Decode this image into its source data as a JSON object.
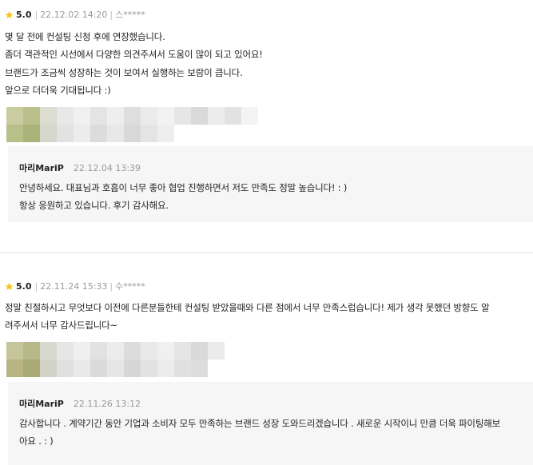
{
  "reviews": [
    {
      "rating": "5.0",
      "date": "22.12.02 14:20",
      "author": "스*****",
      "lines": [
        "몇 달 전에 컨설팅 신청 후에 연장했습니다.",
        "좀더 객관적인 시선에서 다양한 의견주셔서 도움이 많이 되고 있어요!",
        "브랜드가 조금씩 성장하는 것이 보여서 실행하는 보람이 큽니다.",
        "앞으로 더더욱 기대됩니다 :)"
      ],
      "reply": {
        "name": "마리MariP",
        "date": "22.12.04 13:39",
        "lines": [
          "안녕하세요. 대표님과 호흡이 너무 좋아 협업 진행하면서 저도 만족도 정말 높습니다! : )",
          "항상 응원하고 있습니다. 후기 감사해요."
        ]
      }
    },
    {
      "rating": "5.0",
      "date": "22.11.24 15:33",
      "author": "수*****",
      "lines": [
        "정말 친절하시고 무엇보다 이전에 다른분들한테 컨설팅 받았을때와 다른 점에서 너무 만족스럽습니다! 제가 생각 못했던 방향도 알",
        "려주셔서 너무 감사드립니다~"
      ],
      "reply": {
        "name": "마리MariP",
        "date": "22.11.26 13:12",
        "lines": [
          "감사합니다 . 계약기간 동안 기업과 소비자 모두 만족하는 브랜드 성장 도와드리겠습니다 . 새로운 시작이니 만큼 더욱 파이팅해보",
          "아요 . : )"
        ]
      }
    }
  ],
  "colors": {
    "star": "#f5c518",
    "reply_bg": "#f6f6f6",
    "divider": "#e2e2e2",
    "meta_text": "#9a9a9a"
  }
}
